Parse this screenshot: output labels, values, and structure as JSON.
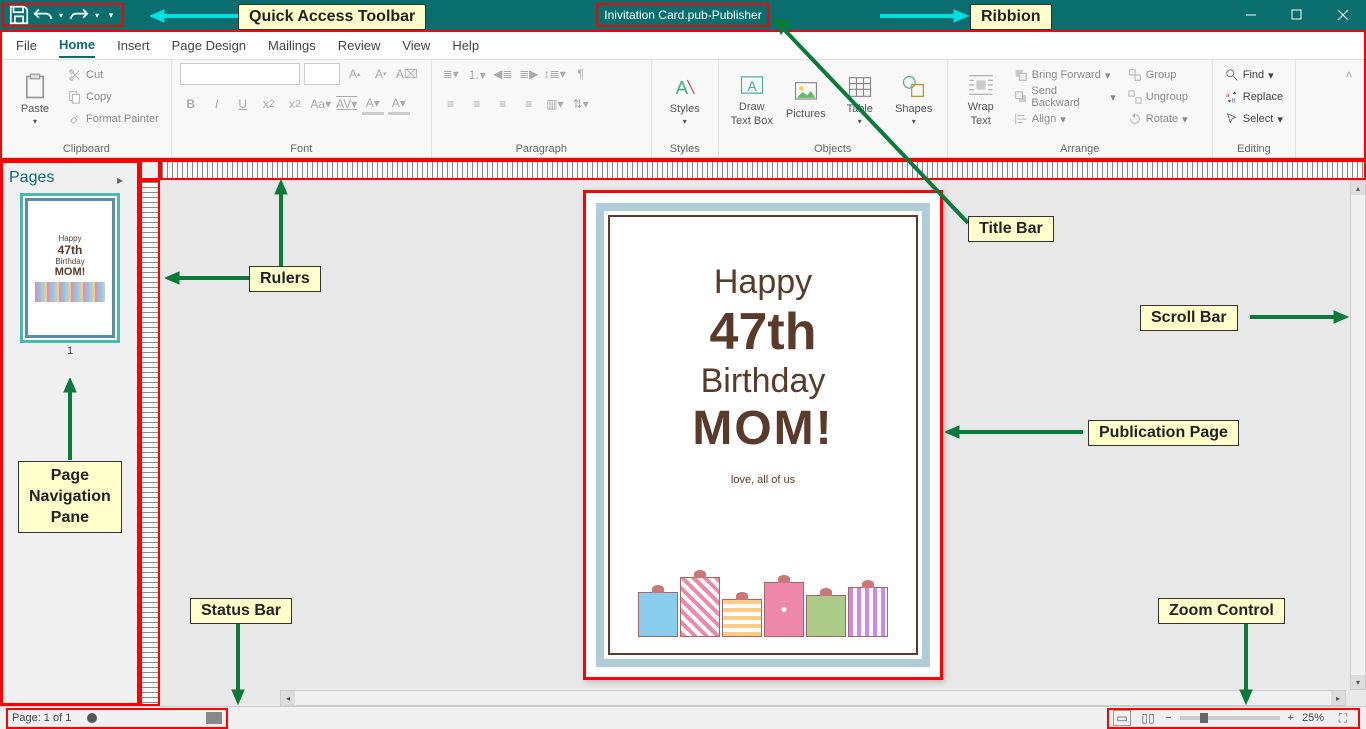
{
  "title": {
    "filename": "Inivitation Card.pub",
    "app": "Publisher",
    "sep": "  -  "
  },
  "tabs": [
    "File",
    "Home",
    "Insert",
    "Page Design",
    "Mailings",
    "Review",
    "View",
    "Help"
  ],
  "active_tab": 1,
  "clipboard": {
    "paste": "Paste",
    "cut": "Cut",
    "copy": "Copy",
    "fp": "Format Painter",
    "label": "Clipboard"
  },
  "font": {
    "label": "Font",
    "b": "B",
    "i": "I",
    "u": "U"
  },
  "para": {
    "label": "Paragraph"
  },
  "styles": {
    "btn": "Styles",
    "label": "Styles"
  },
  "objects": {
    "draw": "Draw",
    "textbox": "Text Box",
    "pics": "Pictures",
    "table": "Table",
    "shapes": "Shapes",
    "label": "Objects"
  },
  "arrange": {
    "wrap": "Wrap",
    "text": "Text",
    "bf": "Bring Forward",
    "sb": "Send Backward",
    "align": "Align",
    "group": "Group",
    "ungroup": "Ungroup",
    "rotate": "Rotate",
    "label": "Arrange"
  },
  "editing": {
    "find": "Find",
    "replace": "Replace",
    "select": "Select",
    "label": "Editing"
  },
  "nav": {
    "title": "Pages",
    "page_num": "1"
  },
  "card": {
    "l1": "Happy",
    "l2": "47th",
    "l3": "Birthday",
    "l4": "MOM!",
    "l5": "love, all of us"
  },
  "status": {
    "page": "Page: 1 of 1",
    "zoom": "25%",
    "plus": "+",
    "minus": "−"
  },
  "callouts": {
    "qat": "Quick Access Toolbar",
    "ribbon": "Ribbion",
    "titlebar": "Title Bar",
    "rulers": "Rulers",
    "scrollbar": "Scroll Bar",
    "pubpage": "Publication Page",
    "navpane": "Page Navigation Pane",
    "statusbar": "Status Bar",
    "zoom": "Zoom Control"
  }
}
